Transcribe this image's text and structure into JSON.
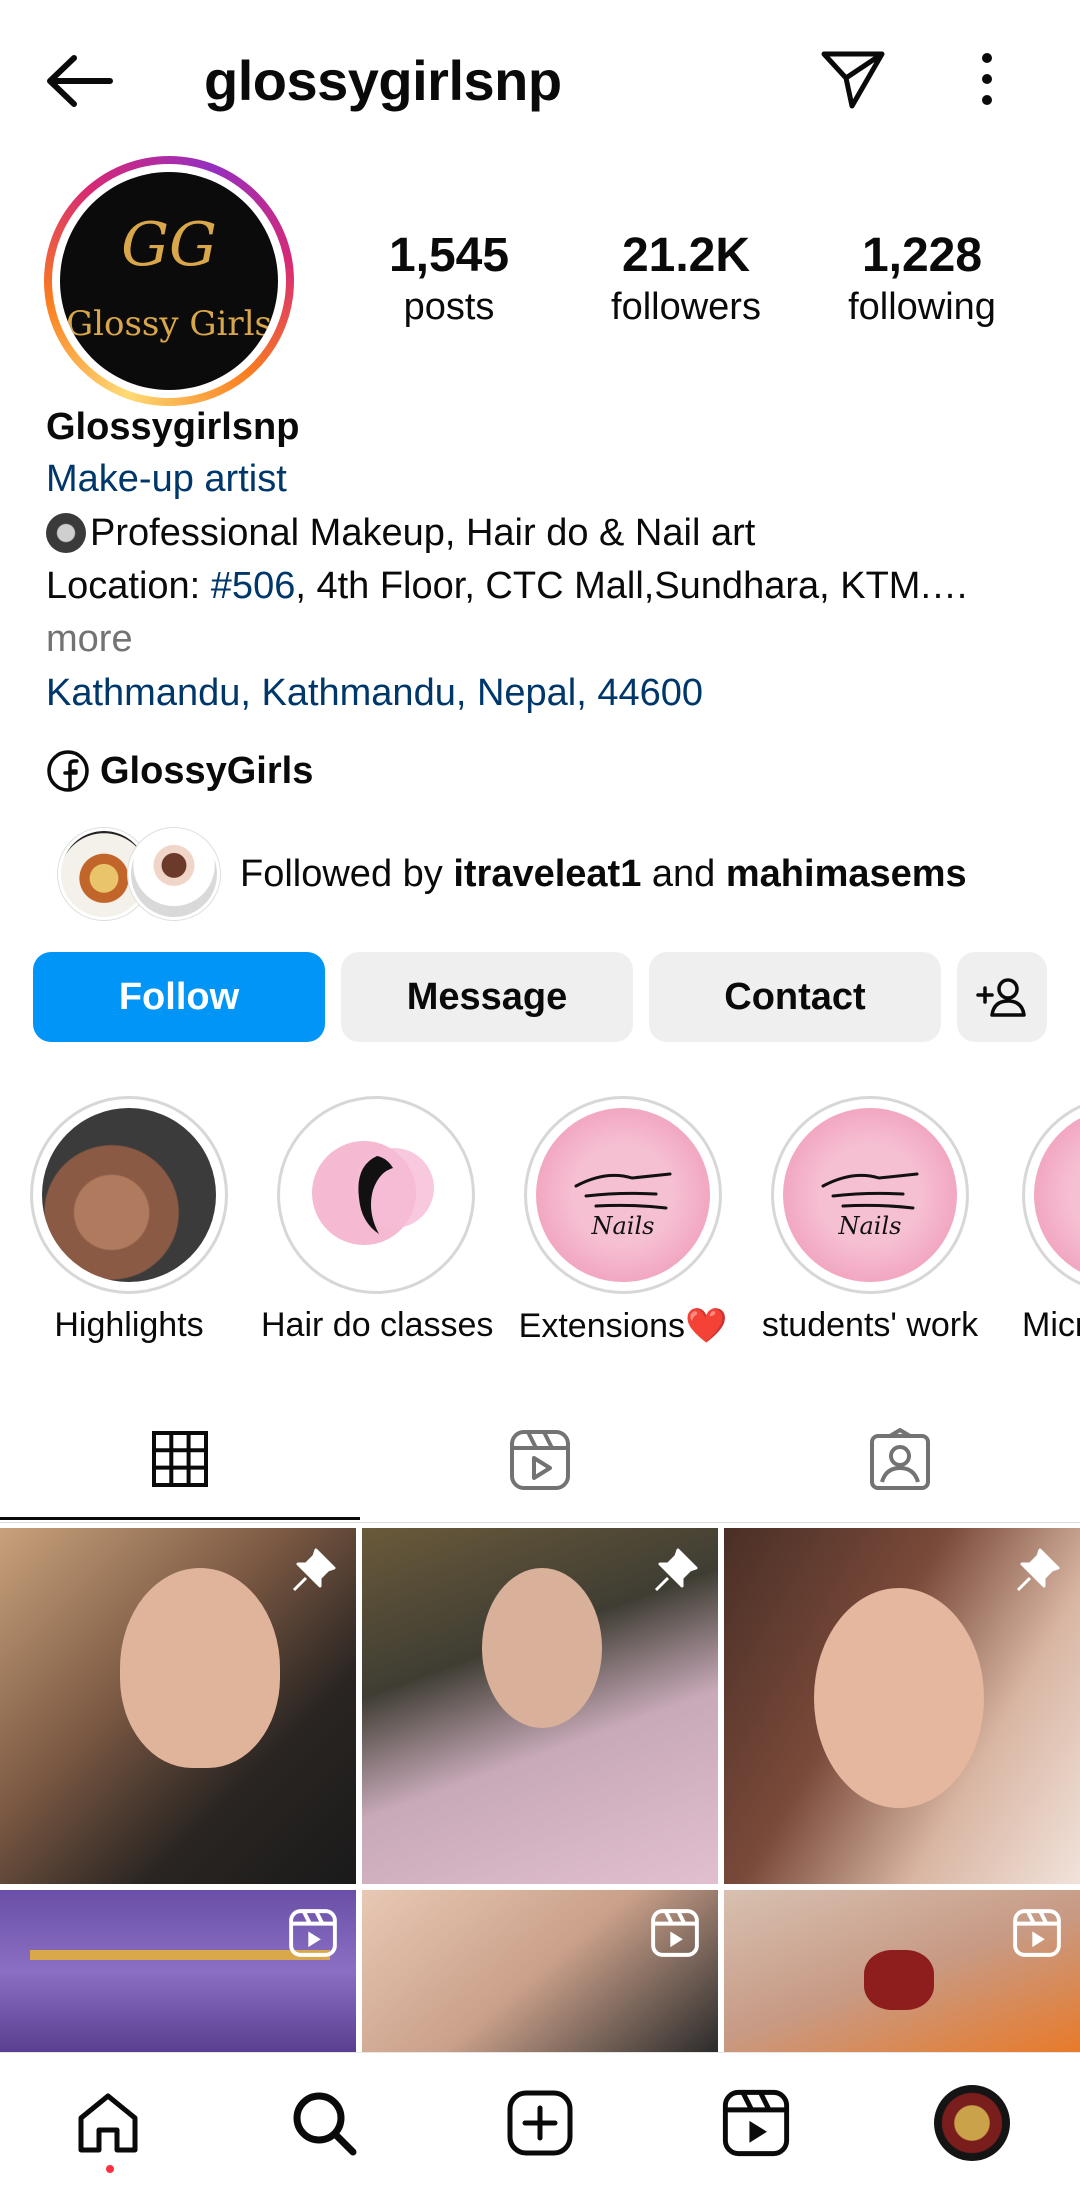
{
  "header": {
    "username": "glossygirlsnp",
    "back_icon": "arrow-left-icon",
    "send_icon": "paper-plane-icon",
    "more_icon": "vertical-dots-icon"
  },
  "avatar": {
    "logo_monogram": "GG",
    "logo_text": "Glossy Girls"
  },
  "stats": [
    {
      "value": "1,545",
      "label": "posts"
    },
    {
      "value": "21.2K",
      "label": "followers"
    },
    {
      "value": "1,228",
      "label": "following"
    }
  ],
  "bio": {
    "name": "Glossygirlsnp",
    "category": "Make-up artist",
    "line1": "Professional Makeup, Hair do & Nail art",
    "location_prefix": "Location: ",
    "location_hashtag": "#506",
    "location_rest": ", 4th Floor, CTC Mall,Sundhara, KTM.…",
    "more": "more",
    "address": "Kathmandu, Kathmandu, Nepal, 44600",
    "facebook": "GlossyGirls"
  },
  "followed_by": {
    "prefix": "Followed by ",
    "user1": "itraveleat1",
    "and": " and ",
    "user2": "mahimasems"
  },
  "buttons": {
    "follow": "Follow",
    "message": "Message",
    "contact": "Contact"
  },
  "highlights": [
    {
      "label": "Highlights"
    },
    {
      "label": "Hair do classes"
    },
    {
      "label": "Extensions❤️"
    },
    {
      "label": "students' work"
    },
    {
      "label": "Micr"
    }
  ],
  "highlight_badge": "Nails",
  "colors": {
    "follow_blue": "#0095f6",
    "link_blue": "#00376b",
    "notification_red": "#ff3040"
  }
}
